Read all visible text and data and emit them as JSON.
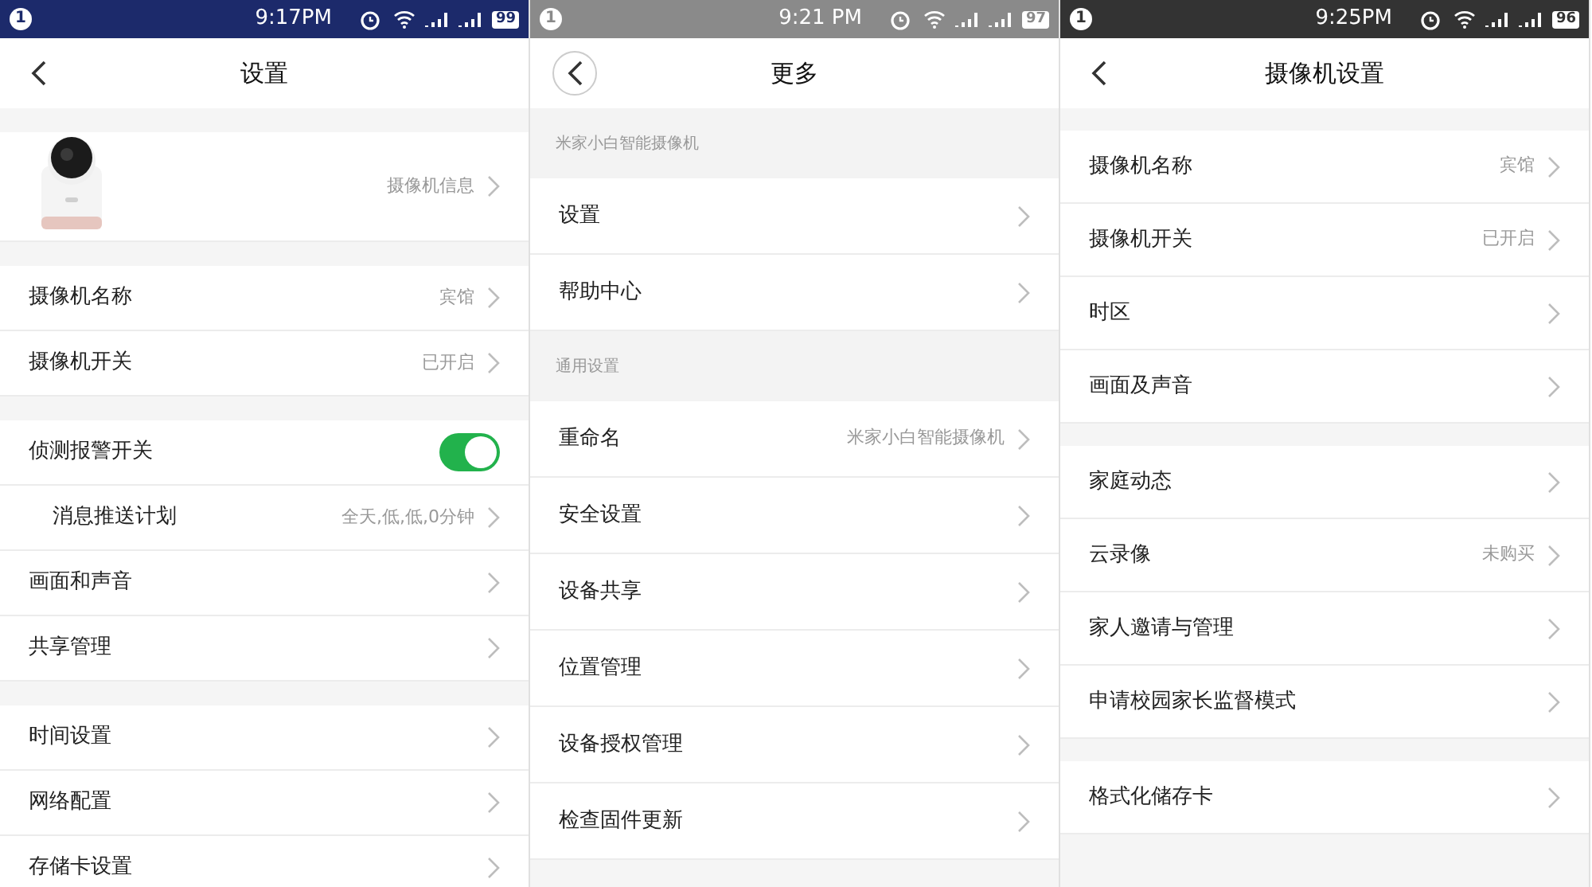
{
  "phones": [
    {
      "status_bar": {
        "color": "#1c2a6b",
        "notification": "1",
        "time": "9:17PM",
        "battery": "99"
      },
      "header": {
        "title": "设置",
        "back_button": {
          "kind": "plain"
        }
      },
      "sections": [
        {
          "rows": [
            {
              "kind": "device",
              "value": "摄像机信息"
            }
          ]
        },
        {
          "rows": [
            {
              "kind": "link",
              "label": "摄像机名称",
              "value": "宾馆"
            },
            {
              "kind": "link",
              "label": "摄像机开关",
              "value": "已开启"
            }
          ]
        },
        {
          "rows": [
            {
              "kind": "toggle",
              "label": "侦测报警开关",
              "on": true
            },
            {
              "kind": "sublink",
              "label": "消息推送计划",
              "value": "全天,低,低,0分钟"
            },
            {
              "kind": "link",
              "label": "画面和声音"
            },
            {
              "kind": "link",
              "label": "共享管理"
            }
          ]
        },
        {
          "rows": [
            {
              "kind": "link",
              "label": "时间设置"
            },
            {
              "kind": "link",
              "label": "网络配置"
            },
            {
              "kind": "link",
              "label": "存储卡设置"
            }
          ]
        }
      ]
    },
    {
      "status_bar": {
        "color": "#8a8a8a",
        "notification": "1",
        "time": "9:21 PM",
        "battery": "97"
      },
      "header": {
        "title": "更多",
        "back_button": {
          "kind": "circle"
        }
      },
      "sections": [
        {
          "title": "米家小白智能摄像机",
          "rows": [
            {
              "kind": "link",
              "label": "设置"
            },
            {
              "kind": "link",
              "label": "帮助中心"
            }
          ]
        },
        {
          "title": "通用设置",
          "rows": [
            {
              "kind": "link",
              "label": "重命名",
              "value": "米家小白智能摄像机"
            },
            {
              "kind": "link",
              "label": "安全设置"
            },
            {
              "kind": "link",
              "label": "设备共享"
            },
            {
              "kind": "link",
              "label": "位置管理"
            },
            {
              "kind": "link",
              "label": "设备授权管理"
            },
            {
              "kind": "link",
              "label": "检查固件更新"
            }
          ]
        }
      ]
    },
    {
      "status_bar": {
        "color": "#333333",
        "notification": "1",
        "time": "9:25PM",
        "battery": "96"
      },
      "header": {
        "title": "摄像机设置",
        "back_button": {
          "kind": "plain"
        }
      },
      "sections": [
        {
          "rows": [
            {
              "kind": "link",
              "label": "摄像机名称",
              "value": "宾馆"
            },
            {
              "kind": "link",
              "label": "摄像机开关",
              "value": "已开启"
            },
            {
              "kind": "link",
              "label": "时区"
            },
            {
              "kind": "link",
              "label": "画面及声音"
            }
          ]
        },
        {
          "rows": [
            {
              "kind": "link",
              "label": "家庭动态"
            },
            {
              "kind": "link",
              "label": "云录像",
              "value": "未购买"
            },
            {
              "kind": "link",
              "label": "家人邀请与管理"
            },
            {
              "kind": "link",
              "label": "申请校园家长监督模式"
            }
          ]
        },
        {
          "rows": [
            {
              "kind": "link",
              "label": "格式化储存卡"
            }
          ]
        }
      ]
    }
  ]
}
